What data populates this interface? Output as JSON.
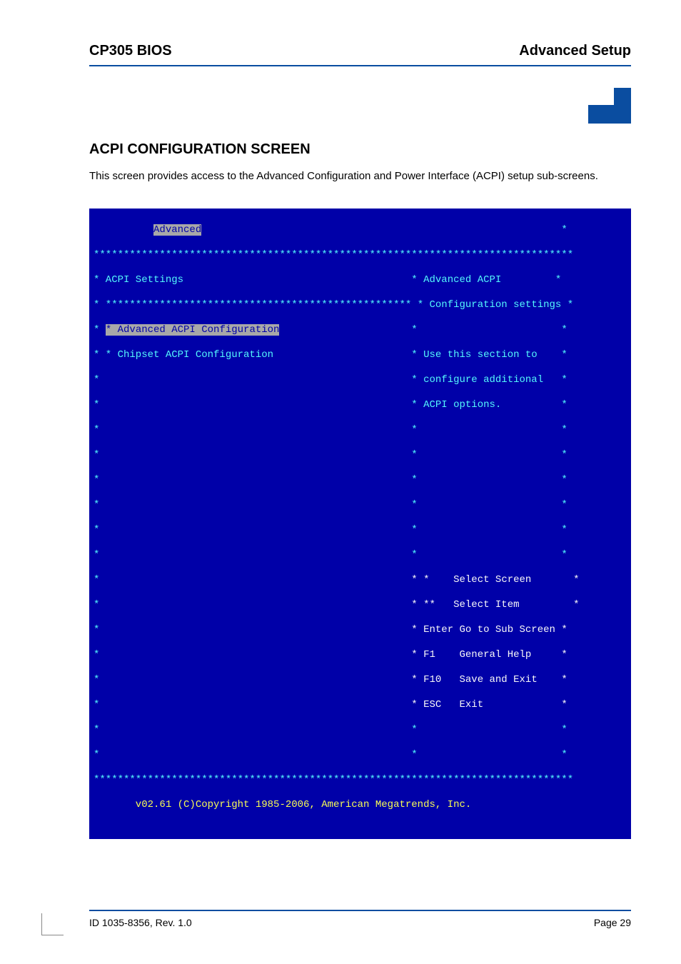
{
  "header": {
    "left": "CP305 BIOS",
    "right": "Advanced Setup"
  },
  "section_title": "ACPI CONFIGURATION SCREEN",
  "section_body": "This screen provides access to the Advanced Configuration and Power Interface (ACPI) setup sub-screens.",
  "bios": {
    "top_tab": "Advanced",
    "border_top": "********************************************************************************",
    "title_line_left": "* ACPI Settings",
    "title_line_right": "* Advanced ACPI         *",
    "rule_line_left": "* *************************************************** ",
    "rule_line_right": "* Configuration settings *",
    "menu1_left": "* * Advanced ACPI Configuration",
    "menu1_right": "*                        *",
    "menu2_left": "* * Chipset ACPI Configuration",
    "menu2_right": "* Use this section to    *",
    "help2": "* configure additional   *",
    "help3": "* ACPI options.          *",
    "blank_left": "*",
    "blank_right": "*                        *",
    "nav_select_screen_l": "* *",
    "nav_select_screen_r": "    Select Screen       *",
    "nav_select_item_l": "* **",
    "nav_select_item_r": "   Select Item         *",
    "nav_enter_l": "* Enter",
    "nav_enter_r": " Go to Sub Screen *",
    "nav_f1_l": "* F1",
    "nav_f1_r": "    General Help     *",
    "nav_f10_l": "* F10",
    "nav_f10_r": "   Save and Exit    *",
    "nav_esc_l": "* ESC",
    "nav_esc_r": "   Exit             *",
    "border_bottom": "********************************************************************************",
    "copyright": "       v02.61 (C)Copyright 1985-2006, American Megatrends, Inc.              "
  },
  "footer": {
    "left": "ID 1035-8356, Rev. 1.0",
    "right": "Page 29"
  }
}
